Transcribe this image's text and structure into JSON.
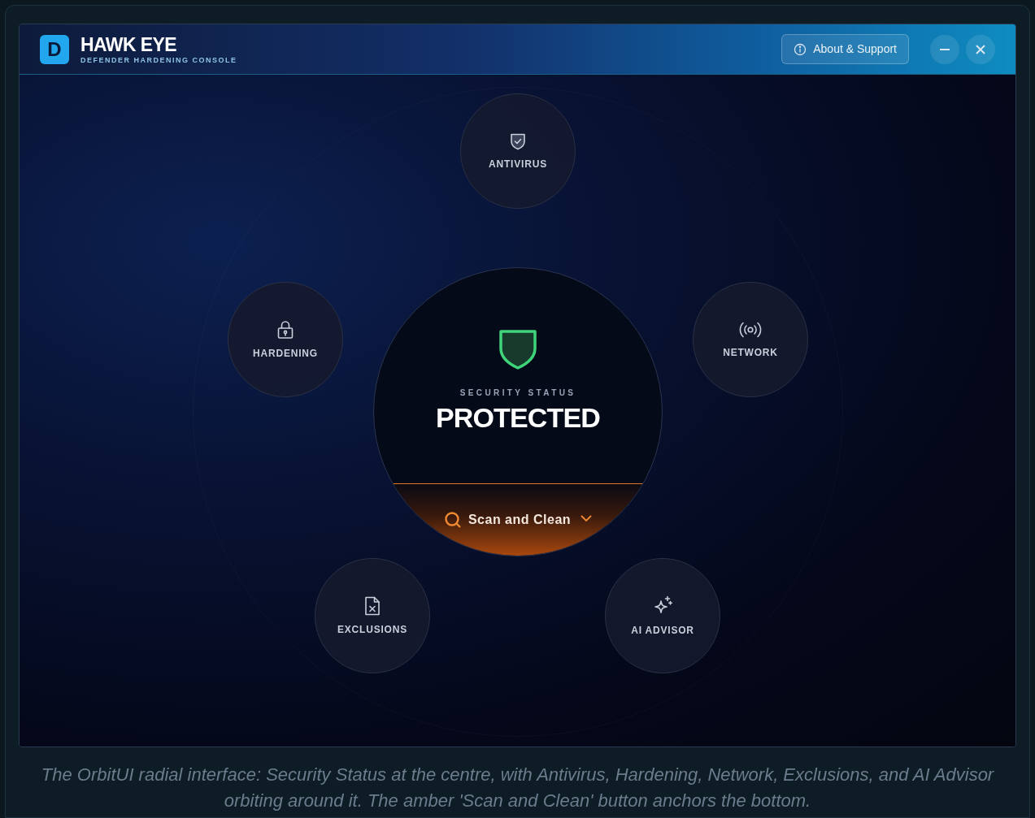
{
  "app": {
    "logo_letter": "D",
    "title": "HAWK EYE",
    "subtitle": "DEFENDER HARDENING CONSOLE",
    "about_button": "About & Support"
  },
  "center": {
    "label": "SECURITY STATUS",
    "status": "PROTECTED",
    "action": "Scan and Clean"
  },
  "nodes": [
    {
      "label": "ANTIVIRUS"
    },
    {
      "label": "HARDENING"
    },
    {
      "label": "NETWORK"
    },
    {
      "label": "EXCLUSIONS"
    },
    {
      "label": "AI ADVISOR"
    }
  ],
  "caption": "The OrbitUI radial interface: Security Status at the centre, with Antivirus, Hardening, Network, Exclusions, and AI Advisor orbiting around it. The amber 'Scan and Clean' button anchors the bottom."
}
